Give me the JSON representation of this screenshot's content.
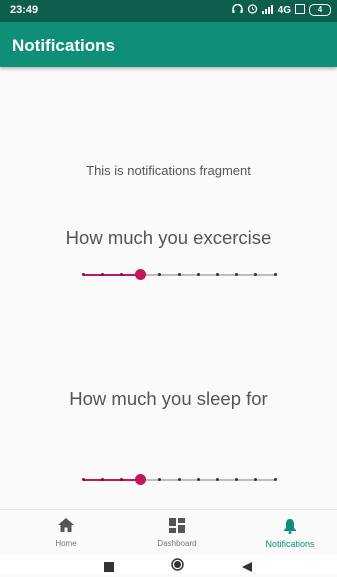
{
  "status_bar": {
    "time": "23:49",
    "network": "4G",
    "battery": "4"
  },
  "app_bar": {
    "title": "Notifications"
  },
  "content": {
    "fragment_text": "This is notifications fragment",
    "questions": [
      {
        "label": "How much you excercise",
        "value_index": 3,
        "steps": 11
      },
      {
        "label": "How much you sleep for",
        "value_index": 3,
        "steps": 11
      }
    ]
  },
  "bottom_nav": {
    "items": [
      {
        "label": "Home",
        "icon": "home-icon",
        "active": false
      },
      {
        "label": "Dashboard",
        "icon": "dashboard-icon",
        "active": false
      },
      {
        "label": "Notifications",
        "icon": "bell-icon",
        "active": true
      }
    ]
  },
  "colors": {
    "status_bar": "#0d5e4f",
    "app_bar": "#0f8f78",
    "slider_active": "#c2185b",
    "nav_active": "#0f8f78"
  }
}
